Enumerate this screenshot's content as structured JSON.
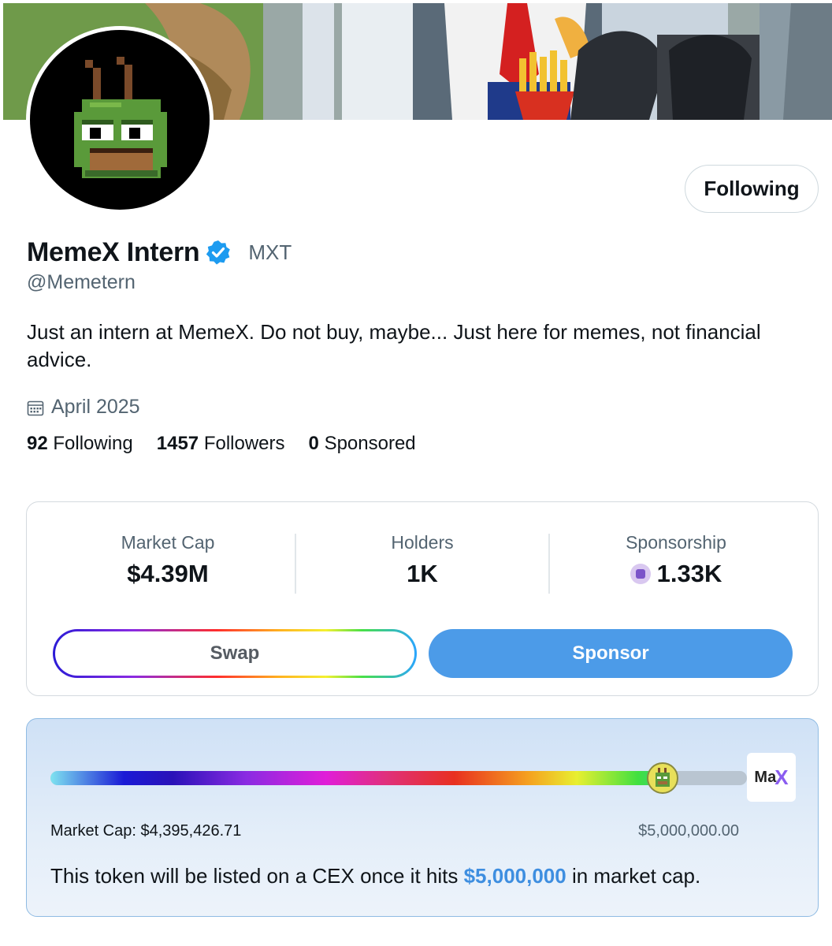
{
  "profile": {
    "display_name": "MemeX Intern",
    "ticker": "MXT",
    "handle": "@Memetern",
    "bio": "Just an intern at MemeX. Do not buy, maybe... Just here for memes, not financial advice.",
    "joined": "April 2025",
    "follow_label": "Following",
    "verified_icon": "verified-badge-icon",
    "stats": [
      {
        "count": "92",
        "label": "Following"
      },
      {
        "count": "1457",
        "label": "Followers"
      },
      {
        "count": "0",
        "label": "Sponsored"
      }
    ]
  },
  "token": {
    "metrics": [
      {
        "label": "Market Cap",
        "value": "$4.39M"
      },
      {
        "label": "Holders",
        "value": "1K"
      },
      {
        "label": "Sponsorship",
        "value": "1.33K",
        "icon": "sponsor-coin-icon"
      }
    ],
    "swap_label": "Swap",
    "sponsor_label": "Sponsor"
  },
  "progress": {
    "fraction": 0.879,
    "current_label": "Market Cap: $4,395,426.71",
    "target_label": "$5,000,000.00",
    "badge_text": "Ma",
    "badge_x": "X",
    "note_before": "This token will be listed on a CEX once it hits ",
    "note_highlight": "$5,000,000",
    "note_after": " in market cap."
  },
  "colors": {
    "accent": "#4c9be8",
    "highlight": "#3e8ee0",
    "verified": "#1d9bf0",
    "muted": "#536471"
  }
}
